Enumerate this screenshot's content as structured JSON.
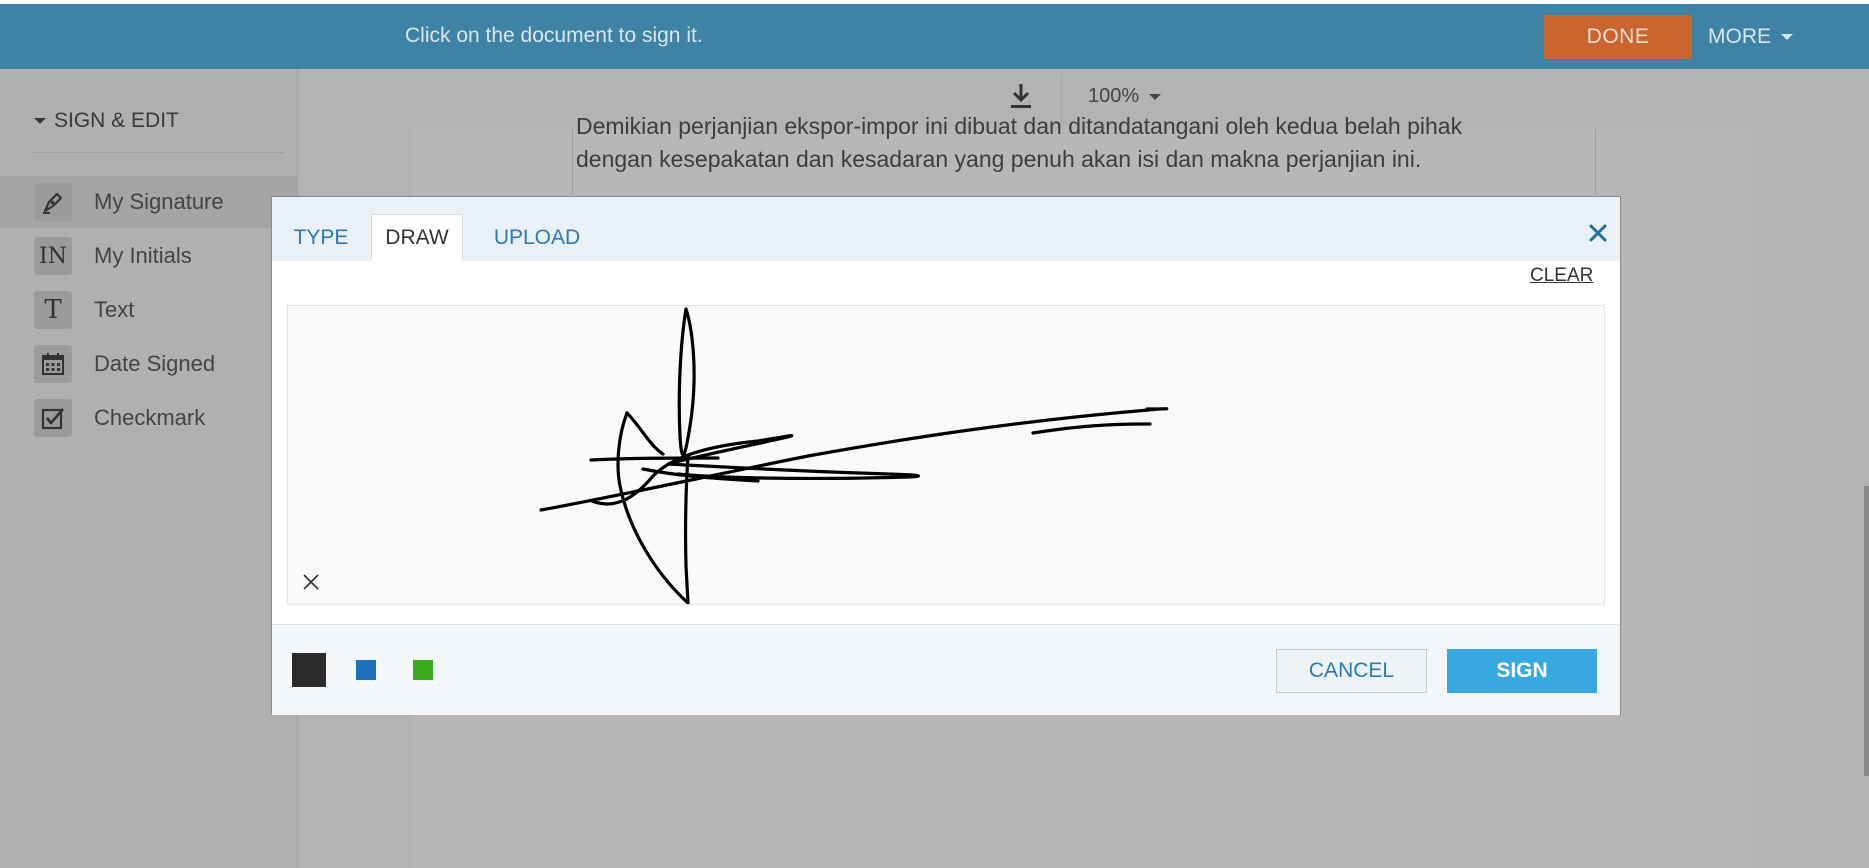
{
  "topbar": {
    "instruction": "Click on the document to sign it.",
    "done_label": "DONE",
    "more_label": "MORE"
  },
  "sidebar": {
    "header": "SIGN & EDIT",
    "items": [
      {
        "label": "My Signature",
        "icon": "pen-nib-icon",
        "active": true
      },
      {
        "label": "My Initials",
        "icon": "initials-icon",
        "icon_text": "IN"
      },
      {
        "label": "Text",
        "icon": "text-icon",
        "icon_text": "T"
      },
      {
        "label": "Date Signed",
        "icon": "calendar-icon"
      },
      {
        "label": "Checkmark",
        "icon": "checkbox-icon"
      }
    ]
  },
  "document": {
    "zoom": "100%",
    "lines": [
      "Demikian perjanjian ekspor-impor ini dibuat dan ditandatangani oleh kedua belah pihak",
      "dengan kesepakatan dan kesadaran yang penuh akan isi dan makna perjanjian ini."
    ]
  },
  "modal": {
    "tabs": [
      {
        "label": "TYPE",
        "active": false
      },
      {
        "label": "DRAW",
        "active": true
      },
      {
        "label": "UPLOAD",
        "active": false
      }
    ],
    "clear_label": "CLEAR",
    "colors": [
      "#2b2b2b",
      "#1f6fbf",
      "#3aaa1c"
    ],
    "selected_color": "#2b2b2b",
    "cancel_label": "CANCEL",
    "sign_label": "SIGN"
  },
  "theme": {
    "topbar_bg": "#3e82a6",
    "done_bg": "#cb6530",
    "sign_bg": "#38a9e0",
    "link_color": "#2b7ab3"
  }
}
